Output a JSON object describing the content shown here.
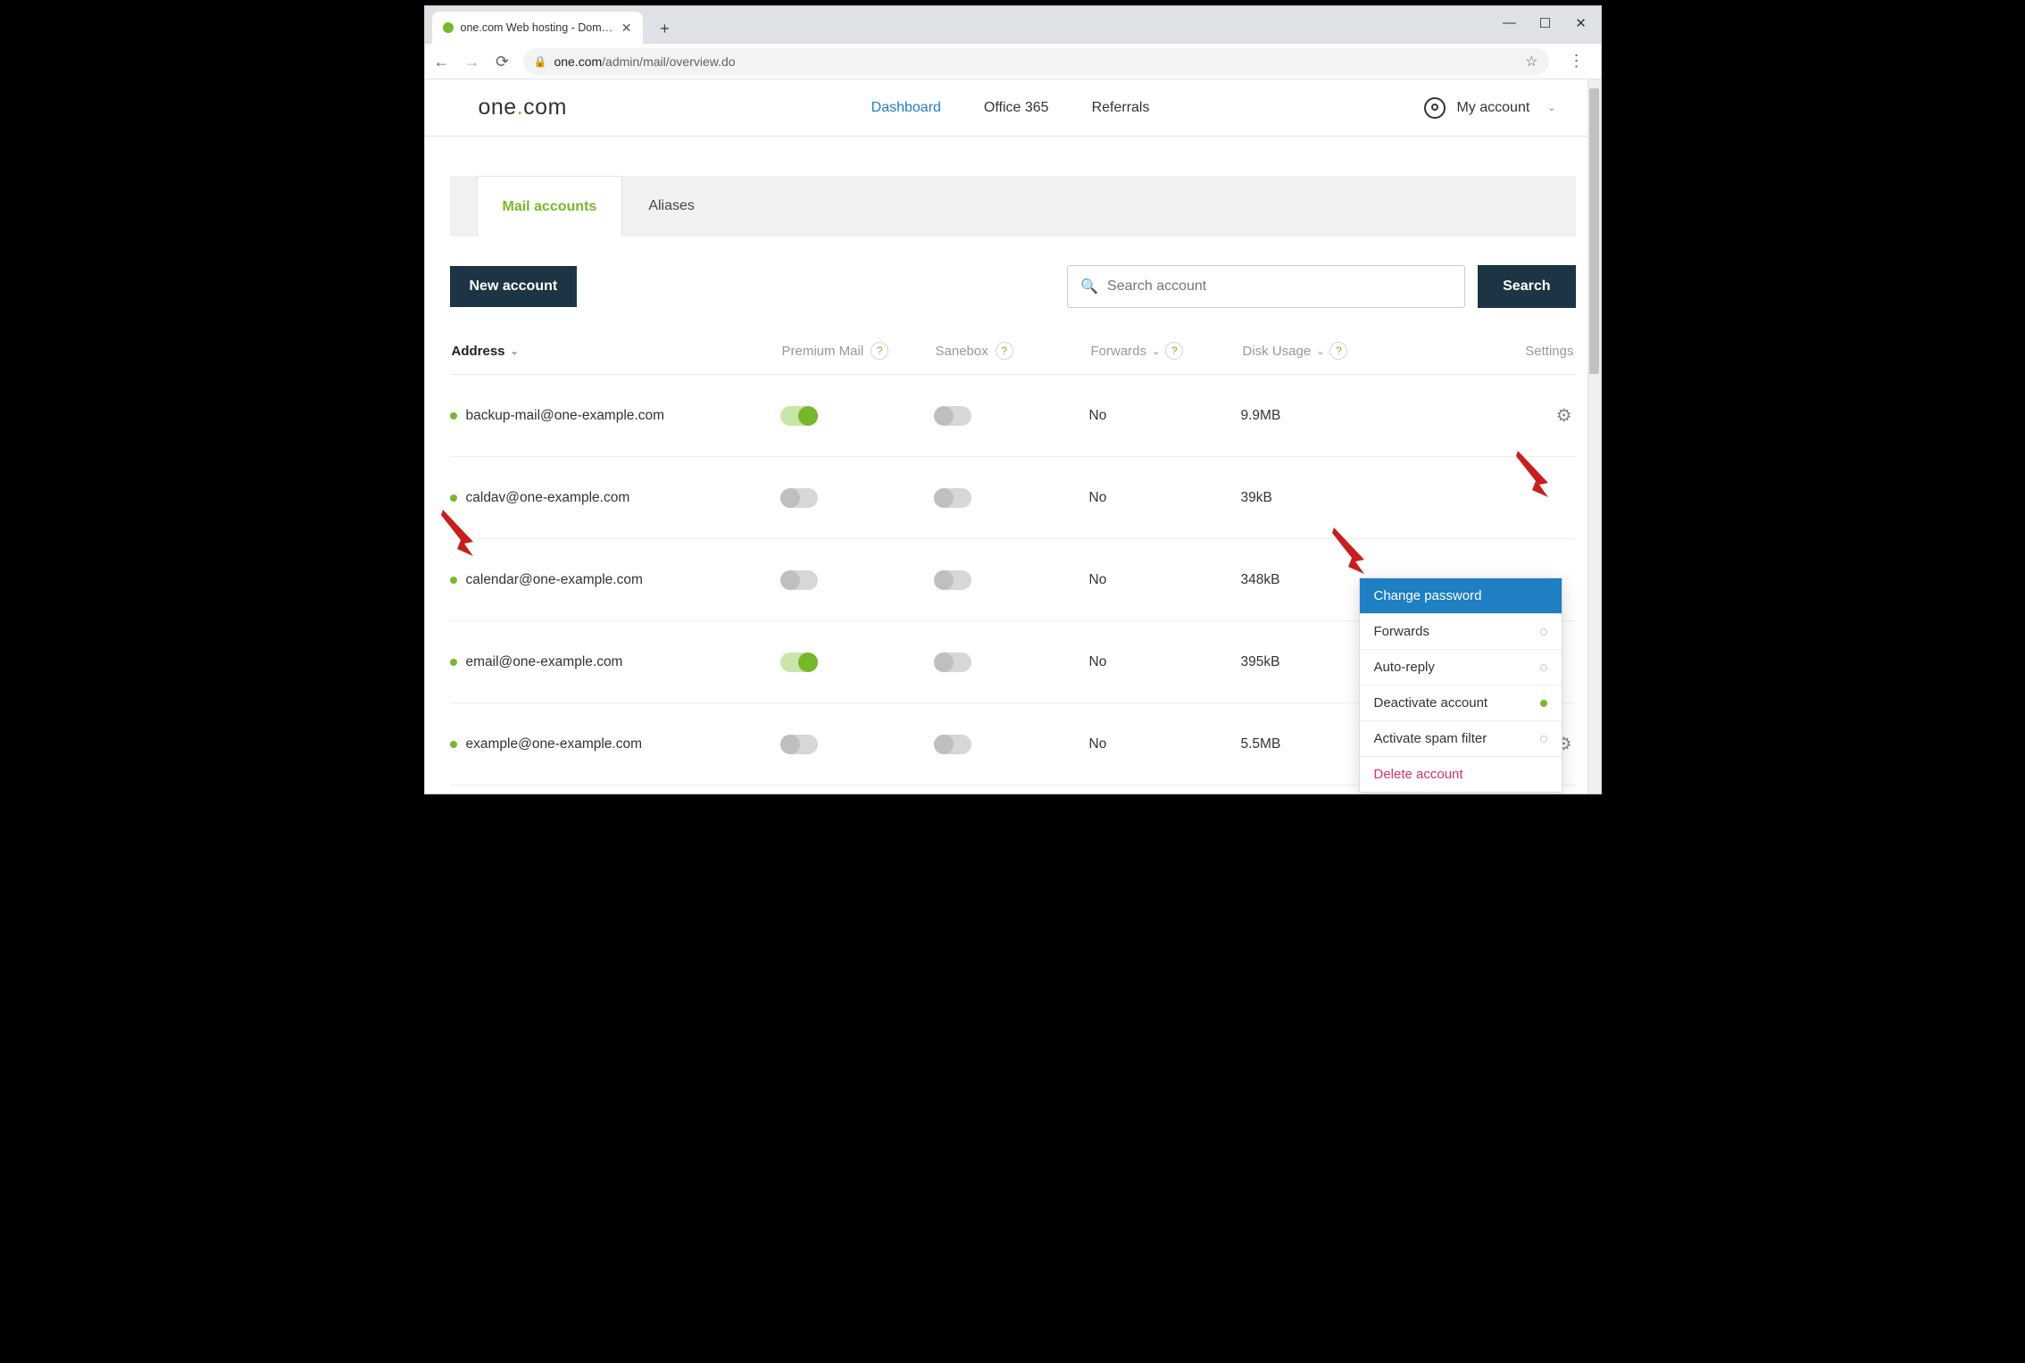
{
  "window": {
    "tab_title": "one.com Web hosting  -  Domain...",
    "url_domain": "one.com",
    "url_path": "/admin/mail/overview.do"
  },
  "header": {
    "logo1": "one",
    "logo2": "com",
    "nav": {
      "dashboard": "Dashboard",
      "office": "Office 365",
      "referrals": "Referrals"
    },
    "account_label": "My account"
  },
  "tabs": {
    "mail_accounts": "Mail accounts",
    "aliases": "Aliases"
  },
  "actions": {
    "new_account": "New account",
    "search_placeholder": "Search account",
    "search_button": "Search"
  },
  "columns": {
    "address": "Address",
    "premium": "Premium Mail",
    "sanebox": "Sanebox",
    "forwards": "Forwards",
    "disk": "Disk Usage",
    "settings": "Settings"
  },
  "rows": [
    {
      "address": "backup-mail@one-example.com",
      "premium_on": true,
      "sanebox_on": false,
      "forwards": "No",
      "disk": "9.9MB",
      "show_gear": true
    },
    {
      "address": "caldav@one-example.com",
      "premium_on": false,
      "sanebox_on": false,
      "forwards": "No",
      "disk": "39kB",
      "show_gear": false
    },
    {
      "address": "calendar@one-example.com",
      "premium_on": false,
      "sanebox_on": false,
      "forwards": "No",
      "disk": "348kB",
      "show_gear": false
    },
    {
      "address": "email@one-example.com",
      "premium_on": true,
      "sanebox_on": false,
      "forwards": "No",
      "disk": "395kB",
      "show_gear": false
    },
    {
      "address": "example@one-example.com",
      "premium_on": false,
      "sanebox_on": false,
      "forwards": "No",
      "disk": "5.5MB",
      "show_gear": true
    }
  ],
  "dropdown": {
    "change_password": "Change password",
    "forwards": "Forwards",
    "auto_reply": "Auto-reply",
    "deactivate": "Deactivate account",
    "spam": "Activate spam filter",
    "delete": "Delete account"
  }
}
